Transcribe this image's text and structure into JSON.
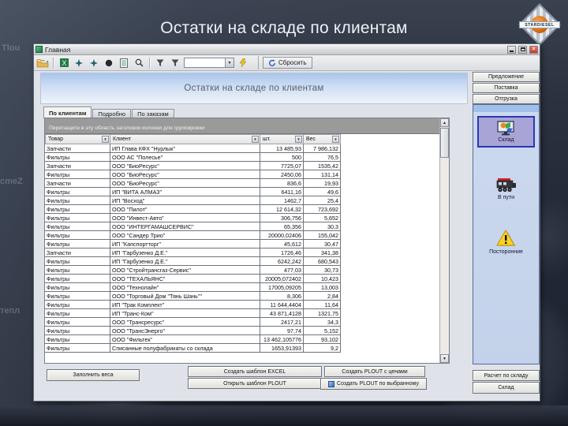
{
  "colors": {
    "banner_blue": "#a9c6ec",
    "selected_purple": "#a9a4d6",
    "warning_yellow": "#ffd21e",
    "close_red": "#cc3a2c",
    "logo_orange": "#d86f10"
  },
  "slide": {
    "title": "Остатки на складе по клиентам",
    "logo_text": "STARDIESEL",
    "bg_fragments": {
      "f1": "Tlou",
      "f2": "cmeZ",
      "f3": "тепл"
    }
  },
  "window": {
    "title": "Главная",
    "toolbar": {
      "combo_value": "",
      "reset_label": "Сбросить",
      "icons": [
        "folder-open-icon",
        "excel-icon",
        "star-left-icon",
        "star-right-icon",
        "circle-icon",
        "xl-page-icon",
        "magnifier-icon",
        "filter-icon",
        "filter-icon",
        "wand-icon",
        "refresh-icon"
      ]
    },
    "banner_title": "Остатки на складе по клиентам",
    "tabs": [
      "По клиентам",
      "Подробно",
      "По заказам"
    ],
    "grid": {
      "group_hint": "Перетащите в эту область заголовок колонки для группировки",
      "columns": [
        "Товар",
        "Клиент",
        "шт.",
        "Вес"
      ],
      "rows": [
        [
          "Запчасти",
          "ИП Глава КФХ \"Нурлык\"",
          "13 485,93",
          "7 986,132"
        ],
        [
          "Фильтры",
          "ООО АС \"Полесье\"",
          "500",
          "76,5"
        ],
        [
          "Запчасти",
          "ООО \"БиоРесурс\"",
          "7725,07",
          "1535,42"
        ],
        [
          "Фильтры",
          "ООО \"БиоРесурс\"",
          "2450,06",
          "131,14"
        ],
        [
          "Запчасти",
          "ООО \"БиоРесурс\"",
          "836,6",
          "19,93"
        ],
        [
          "Фильтры",
          "ИП \"ВИТА АЛМАЗ\"",
          "6411,16",
          "49,6"
        ],
        [
          "Фильтры",
          "ИП \"Восход\"",
          "1462,7",
          "25,4"
        ],
        [
          "Фильтры",
          "ООО \"Пилот\"",
          "12 614,32",
          "723,692"
        ],
        [
          "Фильтры",
          "ООО \"Инвест-Авто\"",
          "306,756",
          "5,652"
        ],
        [
          "Фильтры",
          "ООО \"ИНТЕРГАМАШСЕРВИС\"",
          "65,356",
          "30,3"
        ],
        [
          "Фильтры",
          "ООО \"Сандер Трио\"",
          "20000,02406",
          "155,042"
        ],
        [
          "Фильтры",
          "ИП \"Капспортторг\"",
          "45,612",
          "30,47"
        ],
        [
          "Запчасти",
          "ИП \"Гарбузенко Д.Е.\"",
          "1726,46",
          "341,38"
        ],
        [
          "Фильтры",
          "ИП \"Гарбузенко Д.Е.\"",
          "6242,242",
          "680,543"
        ],
        [
          "Фильтры",
          "ООО \"Стройтрансгаз-Сервис\"",
          "477,03",
          "30,73"
        ],
        [
          "Фильтры",
          "ООО \"ТЕХАЛЬЯНС\"",
          "20005,072402",
          "10,423"
        ],
        [
          "Фильтры",
          "ООО \"Технолайн\"",
          "17005,09205",
          "13,003"
        ],
        [
          "Фильтры",
          "ООО \"Торговый Дом \"Тянь Шань\"\"",
          "8,306",
          "2,84"
        ],
        [
          "Фильтры",
          "ИП \"Трак Комплект\"",
          "11 644,4404",
          "11,64"
        ],
        [
          "Фильтры",
          "ИП \"Транс-Ком\"",
          "43 871,4128",
          "1321,75"
        ],
        [
          "Фильтры",
          "ООО \"Трансресурс\"",
          "2417,21",
          "34,3"
        ],
        [
          "Фильтры",
          "ООО \"ТрансЭнерго\"",
          "97,74",
          "5,152"
        ],
        [
          "Фильтры",
          "ООО \"Фильтек\"",
          "13 462,105776",
          "93,102"
        ],
        [
          "Фильтры",
          "Списанные полуфабрикаты со склада",
          "1653,91393",
          "9,2"
        ]
      ]
    },
    "footer": {
      "fill_weights": "Заполнить веса",
      "create_template": "Создать шаблон EXCEL",
      "open_template": "Открыть шаблон PLOUT",
      "create_plout_prices": "Создать PLOUT с ценами",
      "create_plout_selected": "Создать PLOUT по выбранному"
    },
    "sidebar": {
      "top_buttons": [
        "Предложение",
        "Поставка",
        "Отгрузка"
      ],
      "nav_items": [
        {
          "label": "Склад",
          "icon": "warehouse-monitor-icon",
          "selected": true
        },
        {
          "label": "В пути",
          "icon": "train-icon",
          "selected": false
        },
        {
          "label": "Посторонние",
          "icon": "warning-icon",
          "selected": false
        }
      ],
      "bottom_buttons": [
        "Расчет по складу",
        "Склад"
      ]
    }
  }
}
